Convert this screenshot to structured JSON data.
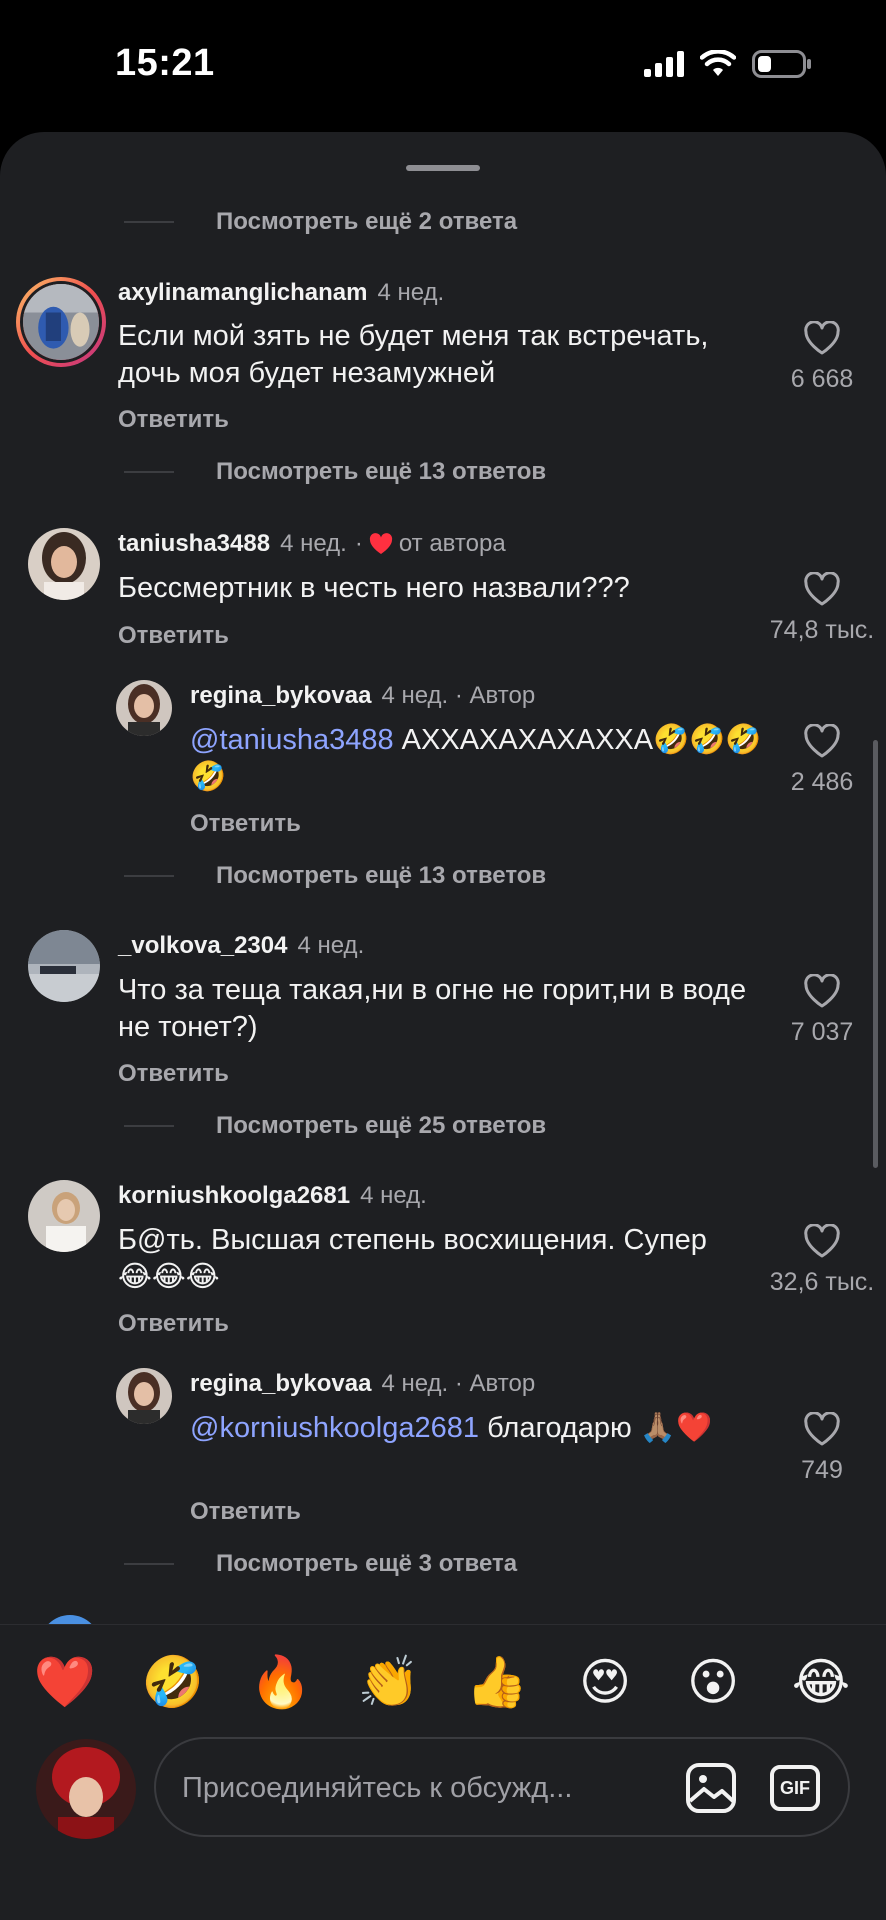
{
  "status": {
    "time": "15:21"
  },
  "thread": {
    "view_more_top": "Посмотреть ещё 2 ответа",
    "comments": [
      {
        "user": "axylinamanglichanam",
        "time": "4 нед.",
        "text": "Если мой зять не будет меня так встречать, дочь моя будет незамужней",
        "reply": "Ответить",
        "likes": "6 668",
        "view_more": "Посмотреть ещё 13 ответов"
      },
      {
        "user": "taniusha3488",
        "time": "4 нед.",
        "extra": "от автора",
        "text": "Бессмертник в честь него назвали???",
        "reply": "Ответить",
        "likes": "74,8 тыс."
      },
      {
        "user": "regina_bykovaa",
        "time": "4 нед. · Автор",
        "mention": "@taniusha3488",
        "text": " АХХАХАХАХАХХА🤣🤣🤣🤣",
        "reply": "Ответить",
        "likes": "2 486",
        "view_more": "Посмотреть ещё 13 ответов"
      },
      {
        "user": "_volkova_2304",
        "time": "4 нед.",
        "text": "Что за теща такая,ни в огне не горит,ни в воде не тонет?)",
        "reply": "Ответить",
        "likes": "7 037",
        "view_more": "Посмотреть ещё 25 ответов"
      },
      {
        "user": "korniushkoolga2681",
        "time": "4 нед.",
        "text": "Б@ть. Высшая степень восхищения. Супер😂😂😂",
        "reply": "Ответить",
        "likes": "32,6 тыс."
      },
      {
        "user": "regina_bykovaa",
        "time": "4 нед. · Автор",
        "mention": "@korniushkoolga2681",
        "text": " благодарю 🙏🏽❤️",
        "reply": "Ответить",
        "likes": "749",
        "view_more": "Посмотреть ещё 3 ответа"
      }
    ]
  },
  "emoji_bar": [
    "❤️",
    "🤣",
    "🔥",
    "👏",
    "👍",
    "😍",
    "😮",
    "😂"
  ],
  "composer": {
    "placeholder": "Присоединяйтесь к обсужд...",
    "gif_label": "GIF"
  },
  "icons": {
    "heart": "heart-outline-icon",
    "image": "image-icon",
    "gif": "gif-icon",
    "author_heart": "red-heart-icon"
  },
  "colors": {
    "background": "#1e1f22",
    "mention": "#8ea4ff",
    "author_heart": "#ff3040",
    "muted": "#a8a8ad"
  }
}
